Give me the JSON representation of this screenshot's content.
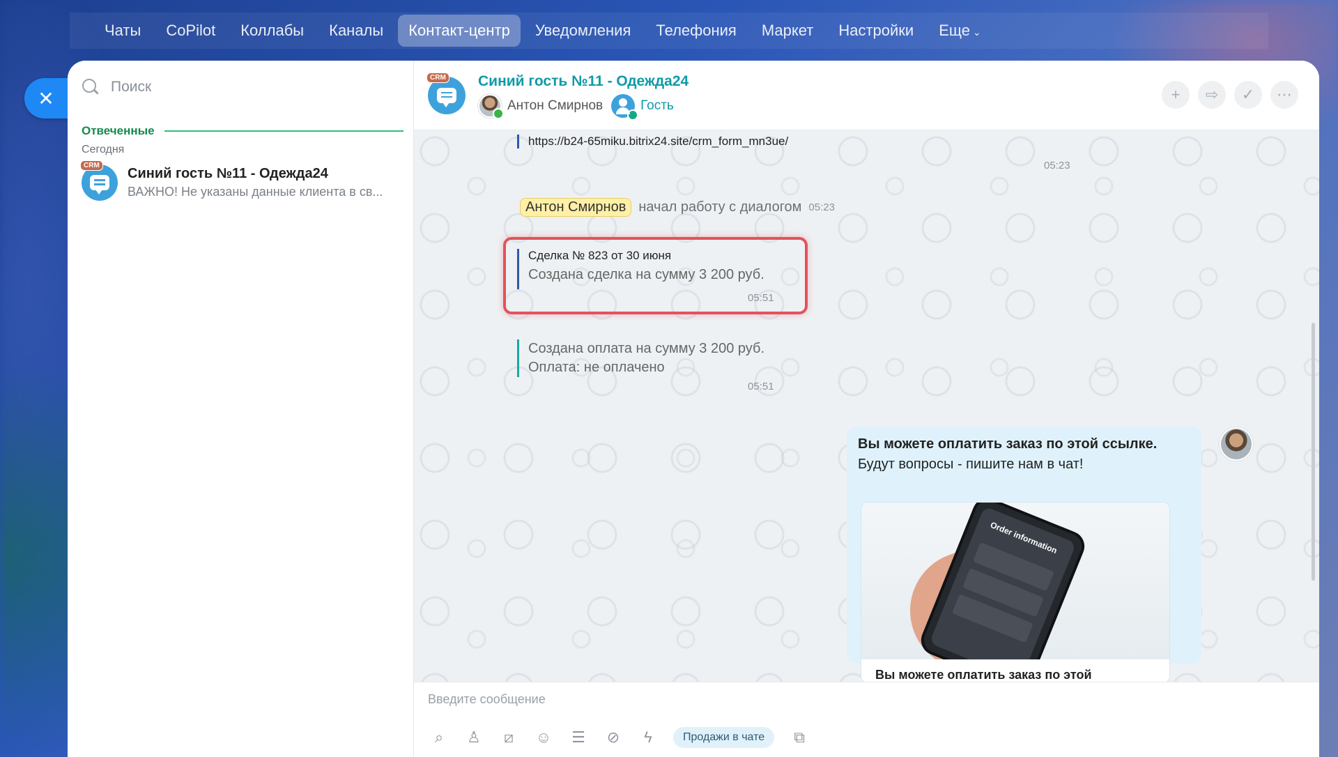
{
  "nav": {
    "items": [
      {
        "label": "Чаты"
      },
      {
        "label": "CoPilot"
      },
      {
        "label": "Коллабы"
      },
      {
        "label": "Каналы"
      },
      {
        "label": "Контакт-центр",
        "active": true
      },
      {
        "label": "Уведомления"
      },
      {
        "label": "Телефония"
      },
      {
        "label": "Маркет"
      },
      {
        "label": "Настройки"
      },
      {
        "label": "Еще"
      }
    ]
  },
  "sidebar": {
    "search_placeholder": "Поиск",
    "section_title": "Отвеченные",
    "section_sub": "Сегодня",
    "chat": {
      "badge": "CRM",
      "name": "Синий гость №11 - Одежда24",
      "preview": "ВАЖНО! Не указаны данные клиента в св..."
    }
  },
  "header": {
    "badge": "CRM",
    "title": "Синий гость №11 - Одежда24",
    "operator": "Антон Смирнов",
    "guest": "Гость",
    "actions": [
      "plus-icon",
      "forward-icon",
      "check-icon",
      "more-icon"
    ]
  },
  "messages": {
    "url": "https://b24-65miku.bitrix24.site/crm_form_mn3ue/",
    "url_time": "05:23",
    "system_name": "Антон Смирнов",
    "system_text": "начал работу с диалогом",
    "system_time": "05:23",
    "deal_title": "Сделка № 823 от 30 июня",
    "deal_text": "Создана сделка на сумму 3 200 руб.",
    "deal_time": "05:51",
    "payment_line1": "Создана оплата на сумму 3 200 руб.",
    "payment_line2": "Оплата: не оплачено",
    "payment_time": "05:51",
    "outgoing_bold": "Вы можете оплатить заказ по этой ссылке.",
    "outgoing_text": "Будут вопросы - пишите нам в чат!",
    "preview_caption": "Вы можете оплатить заказ по этой",
    "phone_heading": "Order information"
  },
  "composer": {
    "placeholder": "Введите сообщение",
    "sales_button": "Продажи в чате"
  },
  "colors": {
    "accent": "#1e88f5",
    "teal": "#0f9aa8",
    "highlight_border": "#e2535b",
    "section_green": "#138a4b"
  }
}
